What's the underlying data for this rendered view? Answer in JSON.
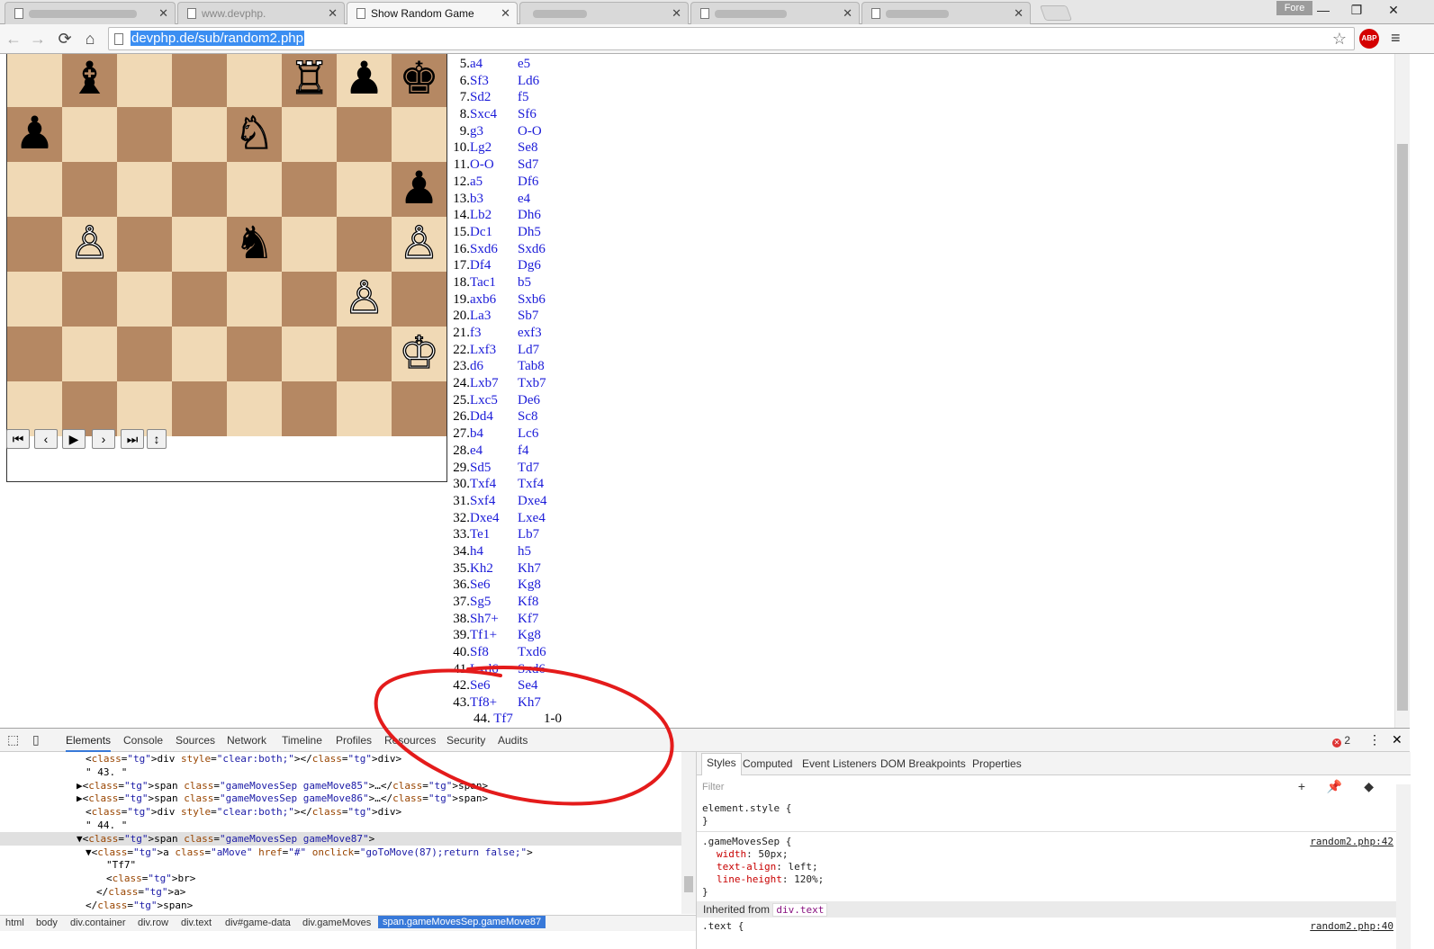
{
  "browser": {
    "tabs": [
      {
        "label": "",
        "blurred": true
      },
      {
        "label": "www.devphp.",
        "blurred": true
      },
      {
        "label": "Show Random Game",
        "blurred": false
      },
      {
        "label": "",
        "blurred": true
      },
      {
        "label": "",
        "blurred": true
      },
      {
        "label": "",
        "blurred": true
      }
    ],
    "profile_label": "Fore",
    "window_controls": {
      "minimize": "—",
      "maximize": "❐",
      "close": "✕"
    },
    "url": "devphp.de/sub/random2.php",
    "abp_label": "ABP"
  },
  "board": {
    "squares": [
      [
        "",
        "♝",
        "",
        "",
        "",
        "♖",
        "♟",
        "♚"
      ],
      [
        "♟",
        "",
        "",
        "",
        "♘",
        "",
        "",
        ""
      ],
      [
        "",
        "",
        "",
        "",
        "",
        "",
        "",
        "♟"
      ],
      [
        "",
        "♙",
        "",
        "",
        "♞",
        "",
        "",
        "♙"
      ],
      [
        "",
        "",
        "",
        "",
        "",
        "",
        "♙",
        ""
      ],
      [
        "",
        "",
        "",
        "",
        "",
        "",
        "",
        "♔"
      ],
      [
        "",
        "",
        "",
        "",
        "",
        "",
        "",
        ""
      ]
    ],
    "piece_colors": [
      [
        "",
        "b",
        "",
        "",
        "",
        "w",
        "b",
        "b"
      ],
      [
        "b",
        "",
        "",
        "",
        "w",
        "",
        "",
        ""
      ],
      [
        "",
        "",
        "",
        "",
        "",
        "",
        "",
        "b"
      ],
      [
        "",
        "w",
        "",
        "",
        "b",
        "",
        "",
        "w"
      ],
      [
        "",
        "",
        "",
        "",
        "",
        "",
        "w",
        ""
      ],
      [
        "",
        "",
        "",
        "",
        "",
        "",
        "",
        "w"
      ],
      [
        "",
        "",
        "",
        "",
        "",
        "",
        "",
        ""
      ]
    ],
    "light_color": "#f0d9b5",
    "dark_color": "#b58863"
  },
  "controls": {
    "first": "⏮",
    "prev": "‹",
    "play": "▶",
    "next": "›",
    "last": "⏭",
    "flip": "↕"
  },
  "moves": [
    {
      "n": "5.",
      "w": "a4",
      "b": "e5"
    },
    {
      "n": "6.",
      "w": "Sf3",
      "b": "Ld6"
    },
    {
      "n": "7.",
      "w": "Sd2",
      "b": "f5"
    },
    {
      "n": "8.",
      "w": "Sxc4",
      "b": "Sf6"
    },
    {
      "n": "9.",
      "w": "g3",
      "b": "O-O"
    },
    {
      "n": "10.",
      "w": "Lg2",
      "b": "Se8"
    },
    {
      "n": "11.",
      "w": "O-O",
      "b": "Sd7"
    },
    {
      "n": "12.",
      "w": "a5",
      "b": "Df6"
    },
    {
      "n": "13.",
      "w": "b3",
      "b": "e4"
    },
    {
      "n": "14.",
      "w": "Lb2",
      "b": "Dh6"
    },
    {
      "n": "15.",
      "w": "Dc1",
      "b": "Dh5"
    },
    {
      "n": "16.",
      "w": "Sxd6",
      "b": "Sxd6"
    },
    {
      "n": "17.",
      "w": "Df4",
      "b": "Dg6"
    },
    {
      "n": "18.",
      "w": "Tac1",
      "b": "b5"
    },
    {
      "n": "19.",
      "w": "axb6",
      "b": "Sxb6"
    },
    {
      "n": "20.",
      "w": "La3",
      "b": "Sb7"
    },
    {
      "n": "21.",
      "w": "f3",
      "b": "exf3"
    },
    {
      "n": "22.",
      "w": "Lxf3",
      "b": "Ld7"
    },
    {
      "n": "23.",
      "w": "d6",
      "b": "Tab8"
    },
    {
      "n": "24.",
      "w": "Lxb7",
      "b": "Txb7"
    },
    {
      "n": "25.",
      "w": "Lxc5",
      "b": "De6"
    },
    {
      "n": "26.",
      "w": "Dd4",
      "b": "Sc8"
    },
    {
      "n": "27.",
      "w": "b4",
      "b": "Lc6"
    },
    {
      "n": "28.",
      "w": "e4",
      "b": "f4"
    },
    {
      "n": "29.",
      "w": "Sd5",
      "b": "Td7"
    },
    {
      "n": "30.",
      "w": "Txf4",
      "b": "Txf4"
    },
    {
      "n": "31.",
      "w": "Sxf4",
      "b": "Dxe4"
    },
    {
      "n": "32.",
      "w": "Dxe4",
      "b": "Lxe4"
    },
    {
      "n": "33.",
      "w": "Te1",
      "b": "Lb7"
    },
    {
      "n": "34.",
      "w": "h4",
      "b": "h5"
    },
    {
      "n": "35.",
      "w": "Kh2",
      "b": "Kh7"
    },
    {
      "n": "36.",
      "w": "Se6",
      "b": "Kg8"
    },
    {
      "n": "37.",
      "w": "Sg5",
      "b": "Kf8"
    },
    {
      "n": "38.",
      "w": "Sh7+",
      "b": "Kf7"
    },
    {
      "n": "39.",
      "w": "Tf1+",
      "b": "Kg8"
    },
    {
      "n": "40.",
      "w": "Sf8",
      "b": "Txd6"
    },
    {
      "n": "41.",
      "w": "Lxd6",
      "b": "Sxd6"
    },
    {
      "n": "42.",
      "w": "Se6",
      "b": "Se4"
    },
    {
      "n": "43.",
      "w": "Tf8+",
      "b": "Kh7"
    }
  ],
  "last_move": {
    "n": "44.",
    "w": "Tf7",
    "result": "1-0"
  },
  "devtools": {
    "tabs": [
      "Elements",
      "Console",
      "Sources",
      "Network",
      "Timeline",
      "Profiles",
      "Resources",
      "Security",
      "Audits"
    ],
    "error_count": "2",
    "dom_lines": [
      {
        "text": "<div style=\"clear:both;\"></div>",
        "indent": 95,
        "selected": false
      },
      {
        "text": "\" 43. \"",
        "indent": 95,
        "selected": false
      },
      {
        "text": "▶<span class=\"gameMovesSep gameMove85\">…</span>",
        "indent": 85,
        "selected": false
      },
      {
        "text": "▶<span class=\"gameMovesSep gameMove86\">…</span>",
        "indent": 85,
        "selected": false
      },
      {
        "text": "<div style=\"clear:both;\"></div>",
        "indent": 95,
        "selected": false
      },
      {
        "text": "\" 44. \"",
        "indent": 95,
        "selected": false
      },
      {
        "text": "▼<span class=\"gameMovesSep gameMove87\">",
        "indent": 85,
        "selected": true
      },
      {
        "text": "▼<a class=\"aMove\" href=\"#\" onclick=\"goToMove(87);return false;\">",
        "indent": 95,
        "selected": false
      },
      {
        "text": "\"Tf7\"",
        "indent": 118,
        "selected": false
      },
      {
        "text": "<br>",
        "indent": 118,
        "selected": false
      },
      {
        "text": "</a>",
        "indent": 107,
        "selected": false
      },
      {
        "text": "</span>",
        "indent": 95,
        "selected": false
      }
    ],
    "breadcrumbs": [
      "html",
      "body",
      "div.container",
      "div.row",
      "div.text",
      "div#game-data",
      "div.gameMoves",
      "span.gameMovesSep.gameMove87"
    ],
    "sidebar_tabs": [
      "Styles",
      "Computed",
      "Event Listeners",
      "DOM Breakpoints",
      "Properties"
    ],
    "filter_placeholder": "Filter",
    "style_tools": "+ 📌 ◆",
    "element_style": "element.style {\n}",
    "rule_selector": ".gameMovesSep {",
    "rule_props": [
      {
        "name": "width",
        "value": "50px;"
      },
      {
        "name": "text-align",
        "value": "left;"
      },
      {
        "name": "line-height",
        "value": "120%;"
      }
    ],
    "rule_close": "}",
    "rule_source": "random2.php:42",
    "inherited_label": "Inherited from",
    "inherited_class": "div.text",
    "text_rule": ".text {",
    "text_source": "random2.php:40"
  }
}
